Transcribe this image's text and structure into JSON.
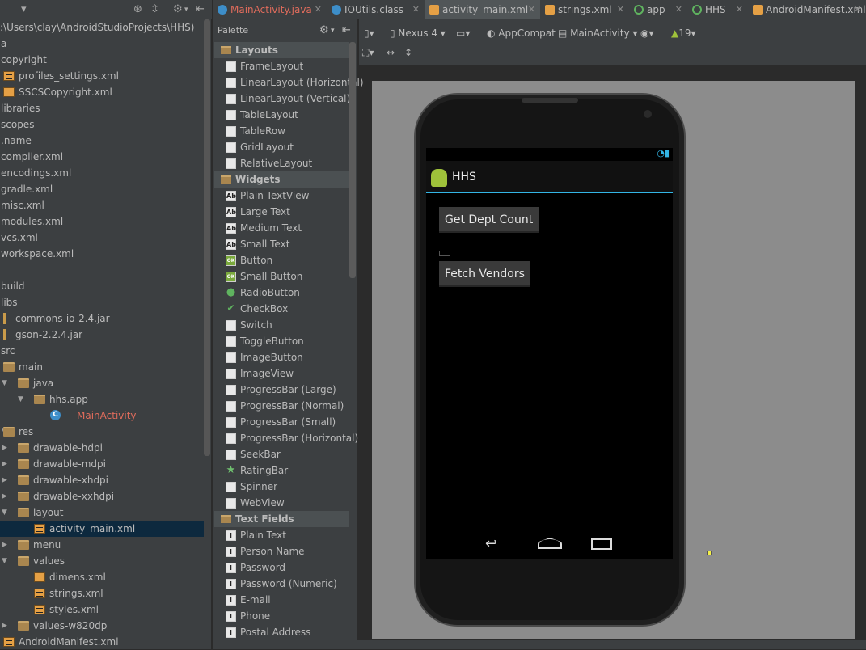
{
  "tree": {
    "path": ":\\Users\\clay\\AndroidStudioProjects\\HHS)",
    "items": [
      {
        "label": "a",
        "icon": "none",
        "indent": 0,
        "arrow": ""
      },
      {
        "label": "copyright",
        "icon": "none",
        "indent": 0,
        "arrow": ""
      },
      {
        "label": "profiles_settings.xml",
        "icon": "xml",
        "indent": 1,
        "arrow": ""
      },
      {
        "label": "SSCSCopyright.xml",
        "icon": "xml",
        "indent": 1,
        "arrow": ""
      },
      {
        "label": "libraries",
        "icon": "none",
        "indent": 0,
        "arrow": ""
      },
      {
        "label": "scopes",
        "icon": "none",
        "indent": 0,
        "arrow": ""
      },
      {
        "label": ".name",
        "icon": "none",
        "indent": 0,
        "arrow": ""
      },
      {
        "label": "compiler.xml",
        "icon": "none",
        "indent": 0,
        "arrow": ""
      },
      {
        "label": "encodings.xml",
        "icon": "none",
        "indent": 0,
        "arrow": ""
      },
      {
        "label": "gradle.xml",
        "icon": "none",
        "indent": 0,
        "arrow": ""
      },
      {
        "label": "misc.xml",
        "icon": "none",
        "indent": 0,
        "arrow": ""
      },
      {
        "label": "modules.xml",
        "icon": "none",
        "indent": 0,
        "arrow": ""
      },
      {
        "label": "vcs.xml",
        "icon": "none",
        "indent": 0,
        "arrow": ""
      },
      {
        "label": "workspace.xml",
        "icon": "none",
        "indent": 0,
        "arrow": ""
      },
      {
        "label": "",
        "icon": "none",
        "indent": 0,
        "arrow": ""
      },
      {
        "label": "build",
        "icon": "none",
        "indent": 0,
        "arrow": ""
      },
      {
        "label": "libs",
        "icon": "none",
        "indent": 0,
        "arrow": ""
      },
      {
        "label": "commons-io-2.4.jar",
        "icon": "jar",
        "indent": 1,
        "arrow": ""
      },
      {
        "label": "gson-2.2.4.jar",
        "icon": "jar",
        "indent": 1,
        "arrow": ""
      },
      {
        "label": "src",
        "icon": "none",
        "indent": 0,
        "arrow": ""
      },
      {
        "label": "main",
        "icon": "folder",
        "indent": 1,
        "arrow": ""
      },
      {
        "label": "java",
        "icon": "folder",
        "indent": 2,
        "arrow": "down"
      },
      {
        "label": "hhs.app",
        "icon": "folder",
        "indent": 3,
        "arrow": "down"
      },
      {
        "label": "MainActivity",
        "icon": "class",
        "indent": 4,
        "arrow": ""
      },
      {
        "label": "res",
        "icon": "folder",
        "indent": 1,
        "arrow": "down"
      },
      {
        "label": "drawable-hdpi",
        "icon": "folder",
        "indent": 2,
        "arrow": "right"
      },
      {
        "label": "drawable-mdpi",
        "icon": "folder",
        "indent": 2,
        "arrow": "right"
      },
      {
        "label": "drawable-xhdpi",
        "icon": "folder",
        "indent": 2,
        "arrow": "right"
      },
      {
        "label": "drawable-xxhdpi",
        "icon": "folder",
        "indent": 2,
        "arrow": "right"
      },
      {
        "label": "layout",
        "icon": "folder",
        "indent": 2,
        "arrow": "down"
      },
      {
        "label": "activity_main.xml",
        "icon": "xml",
        "indent": 3,
        "arrow": "",
        "selected": true
      },
      {
        "label": "menu",
        "icon": "folder",
        "indent": 2,
        "arrow": "right"
      },
      {
        "label": "values",
        "icon": "folder",
        "indent": 2,
        "arrow": "down"
      },
      {
        "label": "dimens.xml",
        "icon": "xml",
        "indent": 3,
        "arrow": ""
      },
      {
        "label": "strings.xml",
        "icon": "xml",
        "indent": 3,
        "arrow": ""
      },
      {
        "label": "styles.xml",
        "icon": "xml",
        "indent": 3,
        "arrow": ""
      },
      {
        "label": "values-w820dp",
        "icon": "folder",
        "indent": 2,
        "arrow": "right"
      },
      {
        "label": "AndroidManifest.xml",
        "icon": "xml",
        "indent": 1,
        "arrow": ""
      }
    ]
  },
  "tabs": [
    {
      "label": "MainActivity.java",
      "icon": "class",
      "active": false,
      "red": true
    },
    {
      "label": "IOUtils.class",
      "icon": "class",
      "active": false,
      "red": false
    },
    {
      "label": "activity_main.xml",
      "icon": "xml",
      "active": true,
      "red": false
    },
    {
      "label": "strings.xml",
      "icon": "xml",
      "active": false,
      "red": false
    },
    {
      "label": "app",
      "icon": "module",
      "active": false,
      "red": false
    },
    {
      "label": "HHS",
      "icon": "module",
      "active": false,
      "red": false
    },
    {
      "label": "AndroidManifest.xml",
      "icon": "xml",
      "active": false,
      "red": false
    }
  ],
  "palette": {
    "title": "Palette",
    "rows": [
      {
        "type": "cat",
        "label": "Layouts"
      },
      {
        "type": "item",
        "label": "FrameLayout",
        "glyph": ""
      },
      {
        "type": "item",
        "label": "LinearLayout (Horizontal)",
        "glyph": ""
      },
      {
        "type": "item",
        "label": "LinearLayout (Vertical)",
        "glyph": ""
      },
      {
        "type": "item",
        "label": "TableLayout",
        "glyph": ""
      },
      {
        "type": "item",
        "label": "TableRow",
        "glyph": ""
      },
      {
        "type": "item",
        "label": "GridLayout",
        "glyph": ""
      },
      {
        "type": "item",
        "label": "RelativeLayout",
        "glyph": ""
      },
      {
        "type": "cat",
        "label": "Widgets"
      },
      {
        "type": "item",
        "label": "Plain TextView",
        "glyph": "Ab"
      },
      {
        "type": "item",
        "label": "Large Text",
        "glyph": "Ab"
      },
      {
        "type": "item",
        "label": "Medium Text",
        "glyph": "Ab"
      },
      {
        "type": "item",
        "label": "Small Text",
        "glyph": "Ab"
      },
      {
        "type": "item",
        "label": "Button",
        "glyph": "OK"
      },
      {
        "type": "item",
        "label": "Small Button",
        "glyph": "OK"
      },
      {
        "type": "item",
        "label": "RadioButton",
        "glyph": "●"
      },
      {
        "type": "item",
        "label": "CheckBox",
        "glyph": "✔"
      },
      {
        "type": "item",
        "label": "Switch",
        "glyph": ""
      },
      {
        "type": "item",
        "label": "ToggleButton",
        "glyph": ""
      },
      {
        "type": "item",
        "label": "ImageButton",
        "glyph": ""
      },
      {
        "type": "item",
        "label": "ImageView",
        "glyph": ""
      },
      {
        "type": "item",
        "label": "ProgressBar (Large)",
        "glyph": ""
      },
      {
        "type": "item",
        "label": "ProgressBar (Normal)",
        "glyph": ""
      },
      {
        "type": "item",
        "label": "ProgressBar (Small)",
        "glyph": ""
      },
      {
        "type": "item",
        "label": "ProgressBar (Horizontal)",
        "glyph": ""
      },
      {
        "type": "item",
        "label": "SeekBar",
        "glyph": ""
      },
      {
        "type": "item",
        "label": "RatingBar",
        "glyph": "★"
      },
      {
        "type": "item",
        "label": "Spinner",
        "glyph": ""
      },
      {
        "type": "item",
        "label": "WebView",
        "glyph": ""
      },
      {
        "type": "cat",
        "label": "Text Fields"
      },
      {
        "type": "item",
        "label": "Plain Text",
        "glyph": "I"
      },
      {
        "type": "item",
        "label": "Person Name",
        "glyph": "I"
      },
      {
        "type": "item",
        "label": "Password",
        "glyph": "I"
      },
      {
        "type": "item",
        "label": "Password (Numeric)",
        "glyph": "I"
      },
      {
        "type": "item",
        "label": "E-mail",
        "glyph": "I"
      },
      {
        "type": "item",
        "label": "Phone",
        "glyph": "I"
      },
      {
        "type": "item",
        "label": "Postal Address",
        "glyph": "I"
      }
    ]
  },
  "toolbar": {
    "device": "Nexus 4",
    "theme": "AppCompat",
    "activity": "MainActivity",
    "api": "19"
  },
  "phone": {
    "app_title": "HHS",
    "button1": "Get Dept Count",
    "button2": "Fetch Vendors"
  },
  "colors": {
    "accent": "#33b5e5",
    "selection": "#0d293e",
    "bg": "#3c3f41"
  }
}
